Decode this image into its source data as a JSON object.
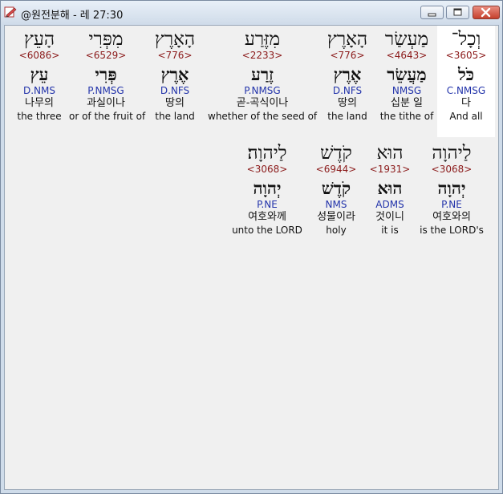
{
  "window": {
    "title": "@원전분해 - 레 27:30",
    "buttons": {
      "minimize": "minimize-icon",
      "maximize": "maximize-icon",
      "close": "close-icon"
    }
  },
  "row1": [
    {
      "heb": "וְכָל־",
      "strong": "<3605>",
      "lemma": "כֹּל",
      "parse": "C.NMSG",
      "kor": "다",
      "eng": "And all"
    },
    {
      "heb": "מַעְשַׂר",
      "strong": "<4643>",
      "lemma": "מַעֲשֵׂר",
      "parse": "NMSG",
      "kor": "십분 일",
      "eng": "the tithe of"
    },
    {
      "heb": "הָאָרֶץ",
      "strong": "<776>",
      "lemma": "אֶרֶץ",
      "parse": "D.NFS",
      "kor": "땅의",
      "eng": "the land"
    },
    {
      "heb": "מִזֶּרַע",
      "strong": "<2233>",
      "lemma": "זֶרַע",
      "parse": "P.NMSG",
      "kor": "곧-곡식이나",
      "eng": "whether of the seed of"
    },
    {
      "heb": "הָאָרֶץ",
      "strong": "<776>",
      "lemma": "אֶרֶץ",
      "parse": "D.NFS",
      "kor": "땅의",
      "eng": "the land"
    },
    {
      "heb": "מִפְּרִי",
      "strong": "<6529>",
      "lemma": "פְּרִי",
      "parse": "P.NMSG",
      "kor": "과실이나",
      "eng": "or of the fruit of"
    },
    {
      "heb": "הָעֵץ",
      "strong": "<6086>",
      "lemma": "עֵץ",
      "parse": "D.NMS",
      "kor": "나무의",
      "eng": "the three"
    }
  ],
  "row2": [
    {
      "heb": "לַיהוָה",
      "strong": "<3068>",
      "lemma": "יְהוָה",
      "parse": "P.NE",
      "kor": "여호와의",
      "eng": "is the LORD's"
    },
    {
      "heb": "הוּא",
      "strong": "<1931>",
      "lemma": "הוּא",
      "parse": "ADMS",
      "kor": "것이니",
      "eng": "it is"
    },
    {
      "heb": "קֹדֶשׁ",
      "strong": "<6944>",
      "lemma": "קֹדֶשׁ",
      "parse": "NMS",
      "kor": "성물이라",
      "eng": "holy"
    },
    {
      "heb": "לַיהוָה׃",
      "strong": "<3068>",
      "lemma": "יְהוָה",
      "parse": "P.NE",
      "kor": "여호와께",
      "eng": "unto the LORD"
    }
  ]
}
